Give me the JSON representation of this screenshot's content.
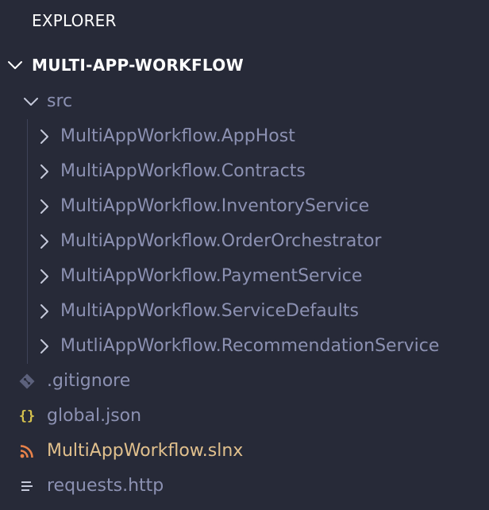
{
  "explorer": {
    "title": "EXPLORER",
    "root": {
      "label": "MULTI-APP-WORKFLOW",
      "expanded": true
    },
    "src_folder": {
      "label": "src",
      "expanded": true,
      "children": [
        "MultiAppWorkflow.AppHost",
        "MultiAppWorkflow.Contracts",
        "MultiAppWorkflow.InventoryService",
        "MultiAppWorkflow.OrderOrchestrator",
        "MultiAppWorkflow.PaymentService",
        "MultiAppWorkflow.ServiceDefaults",
        "MutliAppWorkflow.RecommendationService"
      ]
    },
    "files": [
      {
        "label": ".gitignore",
        "icon": "git-diamond-icon"
      },
      {
        "label": "global.json",
        "icon": "json-braces-icon"
      },
      {
        "label": "MultiAppWorkflow.slnx",
        "icon": "rss-icon"
      },
      {
        "label": "requests.http",
        "icon": "text-lines-icon"
      }
    ]
  },
  "colors": {
    "background": "#272a38",
    "text": "#8c91b2",
    "title": "#ffffff",
    "json_icon": "#d6c24e",
    "rss_icon": "#e8824a",
    "slnx_text": "#e1c08d",
    "guide": "#3e4258"
  }
}
